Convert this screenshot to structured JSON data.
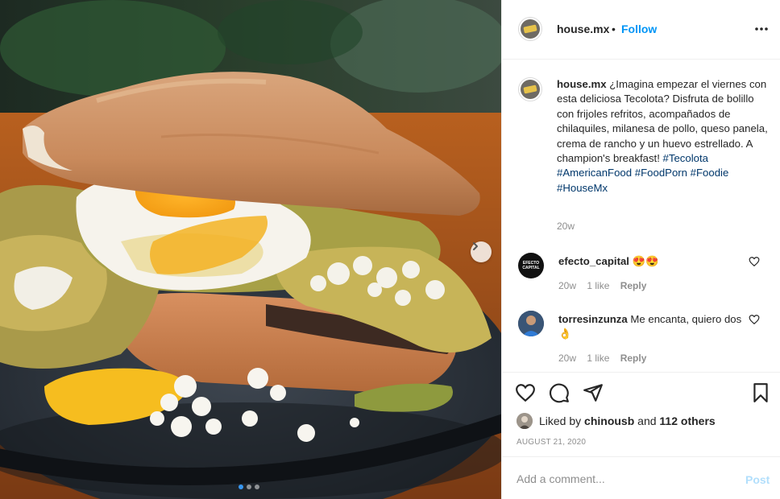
{
  "post": {
    "account": "house.mx",
    "follow_separator": "•",
    "follow_label": "Follow"
  },
  "caption": {
    "username": "house.mx",
    "text": "¿Imagina empezar el viernes con esta deliciosa Tecolota? Disfruta de bolillo con frijoles refritos, acompañados de chilaquiles, milanesa de pollo, queso panela, crema de rancho y un huevo estrellado. A champion's breakfast!",
    "hashtags": "#Tecolota #AmericanFood #FoodPorn #Foodie #HouseMx",
    "time": "20w"
  },
  "comments": [
    {
      "username": "efecto_capital",
      "text": "😍😍",
      "avatar_text": "EFECTO CAPITAL",
      "time": "20w",
      "likes": "1 like",
      "reply_label": "Reply"
    },
    {
      "username": "torresinzunza",
      "text": "Me encanta, quiero dos 👌",
      "time": "20w",
      "likes": "1 like",
      "reply_label": "Reply"
    }
  ],
  "likes": {
    "prefix": "Liked by",
    "user": "chinousb",
    "conjunction": "and",
    "others": "112 others"
  },
  "date": "August 21, 2020",
  "add_comment": {
    "placeholder": "Add a comment...",
    "post_label": "Post"
  },
  "carousel": {
    "slide_count": 3,
    "active_index": 0
  },
  "colors": {
    "link_blue": "#0095f6",
    "hashtag": "#00376b",
    "muted": "#8e8e8e",
    "post_disabled": "#b2dffc",
    "carousel_active_dot": "#3897f0"
  },
  "icons": [
    "more-options-icon",
    "heart-icon",
    "comment-icon",
    "share-icon",
    "bookmark-icon",
    "chevron-right-icon"
  ]
}
